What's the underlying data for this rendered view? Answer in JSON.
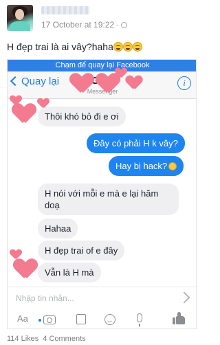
{
  "post": {
    "timestamp": "17 October at 19:22 ·",
    "text": "H đẹp trai là ai vây?haha"
  },
  "screenshot": {
    "return_banner": "Chạm để quay lại Facebook",
    "nav": {
      "back_label": "Quay lại",
      "contact_name": "G N",
      "subtitle": "Messenger",
      "info_label": "i"
    },
    "messages": [
      {
        "direction": "in",
        "text": "Thôi khó bỏ đi e ơi"
      },
      {
        "direction": "out",
        "text": "Đây có phải H k vây?"
      },
      {
        "direction": "out",
        "text": "Hay bị hack?"
      },
      {
        "direction": "in",
        "text": "H nói với mỗi e mà e lại hăm"
      },
      {
        "direction": "in",
        "text": "doạ"
      },
      {
        "direction": "in",
        "text": "Hahaa"
      },
      {
        "direction": "in",
        "text": "H đẹp trai of e đây"
      },
      {
        "direction": "in",
        "text": "Vẫn là H mà"
      }
    ],
    "composer": {
      "placeholder": "Nhập tin nhắn...",
      "aa_label": "Aa"
    }
  },
  "stats": {
    "likes": "114 Likes",
    "comments": "4 Comments"
  },
  "colors": {
    "messenger_blue": "#1e84f0",
    "banner_blue": "#2f80e6",
    "heart_pink": "#f47b8f"
  }
}
